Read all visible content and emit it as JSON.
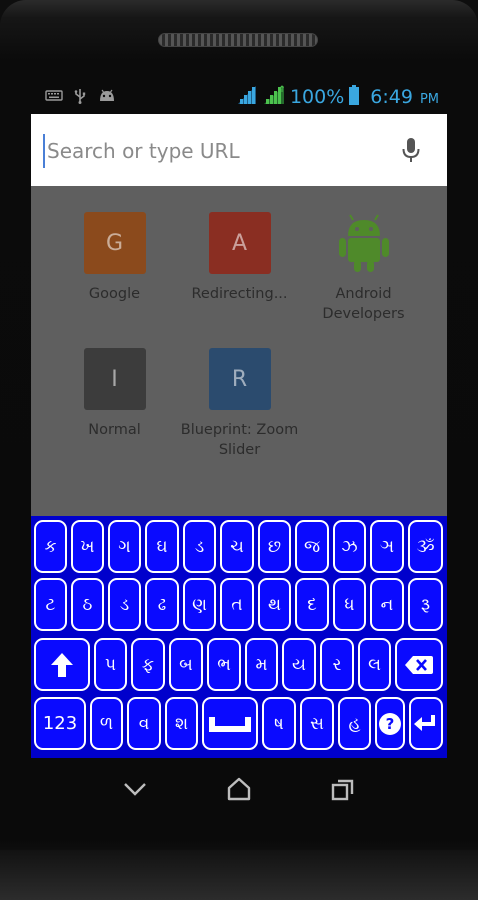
{
  "status_bar": {
    "left_icons": [
      "keyboard-icon",
      "usb-icon",
      "android-debug-icon"
    ],
    "battery_percent": "100%",
    "time": "6:49",
    "ampm": "PM"
  },
  "browser": {
    "search_placeholder": "Search or type URL",
    "mic_icon": "microphone-icon",
    "tiles": [
      {
        "letter": "G",
        "label": "Google",
        "color": "#8b4a1c"
      },
      {
        "letter": "A",
        "label": "Redirecting...",
        "color": "#8a2e22"
      },
      {
        "letter": "",
        "label": "Android Developers",
        "color": "#4f8a2a"
      },
      {
        "letter": "I",
        "label": "Normal",
        "color": "#3c3c3c"
      },
      {
        "letter": "R",
        "label": "Blueprint: Zoom Slider",
        "color": "#2b4b6e"
      }
    ]
  },
  "keyboard": {
    "row1": [
      "ક",
      "ખ",
      "ગ",
      "ઘ",
      "ડ",
      "ચ",
      "છ",
      "જ",
      "ઝ",
      "ઞ",
      "ૐ"
    ],
    "row2": [
      "ટ",
      "ઠ",
      "ડ",
      "ઢ",
      "ણ",
      "ત",
      "થ",
      "દ",
      "ધ",
      "ન",
      "રૂ"
    ],
    "row3": [
      "પ",
      "ફ",
      "બ",
      "ભ",
      "મ",
      "ય",
      "ર",
      "લ"
    ],
    "row4_left": [
      "ળ",
      "વ",
      "શ"
    ],
    "row4_right": [
      "ષ",
      "સ",
      "હ"
    ],
    "numeric_label": "123",
    "help_label": "?",
    "colors": {
      "key_fill": "#0a0aff",
      "key_border": "#ffffff",
      "background": "#0000cc"
    }
  },
  "nav_bar": {
    "icons": [
      "back-icon",
      "home-icon",
      "recents-icon"
    ]
  }
}
